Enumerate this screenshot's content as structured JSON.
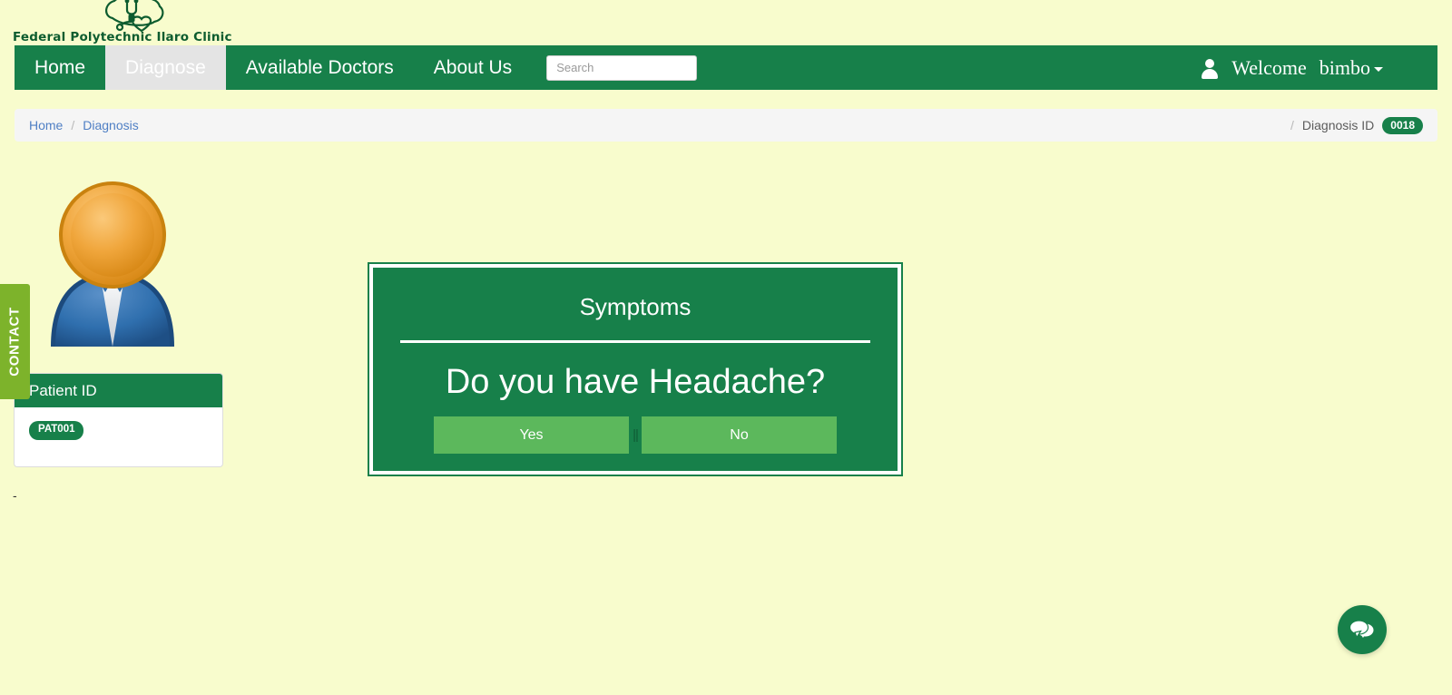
{
  "brand": {
    "name": "Federal Polytechnic Ilaro Clinic",
    "logo_icon": "brain-stethoscope-heart-logo"
  },
  "navbar": {
    "items": [
      {
        "label": "Home",
        "active": false
      },
      {
        "label": "Diagnose",
        "active": true
      },
      {
        "label": "Available Doctors",
        "active": false
      },
      {
        "label": "About Us",
        "active": false
      }
    ],
    "search": {
      "placeholder": "Search",
      "value": ""
    },
    "user": {
      "icon": "user-icon",
      "welcome_label": "Welcome",
      "name": "bimbo",
      "caret": "chevron-down-icon"
    },
    "background_color": "#17804a",
    "active_item_background": "#e4e4e4"
  },
  "breadcrumb": {
    "items": [
      {
        "label": "Home",
        "href": true
      },
      {
        "label": "Diagnosis",
        "href": true
      }
    ],
    "separator": "/",
    "right": {
      "separator": "/",
      "label": "Diagnosis ID",
      "badge": "0018"
    }
  },
  "contact_tab": {
    "label": "CONTACT",
    "color": "#7db32b"
  },
  "patient": {
    "avatar_icon": "user-avatar-illustration",
    "card_title": "Patient ID",
    "patient_id": "PAT001",
    "trailing_text": "-"
  },
  "symptoms": {
    "title": "Symptoms",
    "question": "Do you have Headache?",
    "separator": "||",
    "answers": [
      {
        "label": "Yes",
        "value": "yes"
      },
      {
        "label": "No",
        "value": "no"
      }
    ],
    "card_color": "#17804a",
    "button_color": "#5cb85c"
  },
  "chat": {
    "icon": "chat-bubbles-icon",
    "color": "#17804a"
  },
  "page": {
    "background_color": "#f8fccd"
  }
}
